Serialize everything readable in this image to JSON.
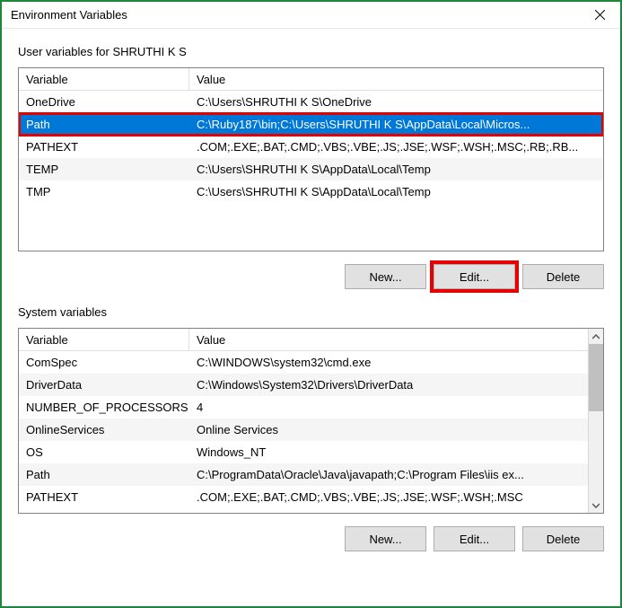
{
  "window": {
    "title": "Environment Variables"
  },
  "userSection": {
    "label": "User variables for SHRUTHI K S",
    "headers": {
      "variable": "Variable",
      "value": "Value"
    },
    "rows": [
      {
        "variable": "OneDrive",
        "value": "C:\\Users\\SHRUTHI K S\\OneDrive",
        "selected": false
      },
      {
        "variable": "Path",
        "value": "C:\\Ruby187\\bin;C:\\Users\\SHRUTHI K S\\AppData\\Local\\Micros...",
        "selected": true
      },
      {
        "variable": "PATHEXT",
        "value": ".COM;.EXE;.BAT;.CMD;.VBS;.VBE;.JS;.JSE;.WSF;.WSH;.MSC;.RB;.RB...",
        "selected": false
      },
      {
        "variable": "TEMP",
        "value": "C:\\Users\\SHRUTHI K S\\AppData\\Local\\Temp",
        "selected": false
      },
      {
        "variable": "TMP",
        "value": "C:\\Users\\SHRUTHI K S\\AppData\\Local\\Temp",
        "selected": false
      }
    ],
    "buttons": {
      "new": "New...",
      "edit": "Edit...",
      "delete": "Delete"
    }
  },
  "systemSection": {
    "label": "System variables",
    "headers": {
      "variable": "Variable",
      "value": "Value"
    },
    "rows": [
      {
        "variable": "ComSpec",
        "value": "C:\\WINDOWS\\system32\\cmd.exe"
      },
      {
        "variable": "DriverData",
        "value": "C:\\Windows\\System32\\Drivers\\DriverData"
      },
      {
        "variable": "NUMBER_OF_PROCESSORS",
        "value": "4"
      },
      {
        "variable": "OnlineServices",
        "value": "Online Services"
      },
      {
        "variable": "OS",
        "value": "Windows_NT"
      },
      {
        "variable": "Path",
        "value": "C:\\ProgramData\\Oracle\\Java\\javapath;C:\\Program Files\\iis ex..."
      },
      {
        "variable": "PATHEXT",
        "value": ".COM;.EXE;.BAT;.CMD;.VBS;.VBE;.JS;.JSE;.WSF;.WSH;.MSC"
      }
    ],
    "buttons": {
      "new": "New...",
      "edit": "Edit...",
      "delete": "Delete"
    }
  }
}
